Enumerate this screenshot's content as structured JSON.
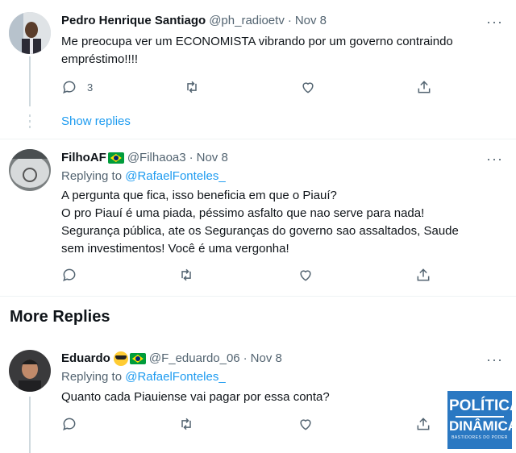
{
  "tweets": [
    {
      "name": "Pedro Henrique Santiago",
      "handle": "@ph_radioetv",
      "time": "Nov 8",
      "text_lines": [
        "Me preocupa ver um ECONOMISTA vibrando por um governo contraindo",
        "empréstimo!!!!"
      ],
      "reply_count": "3",
      "show_replies": "Show replies"
    },
    {
      "name": "FilhoAF",
      "handle": "@Filhaoa3",
      "time": "Nov 8",
      "replying_to": "Replying to",
      "mention": "@RafaelFonteles_",
      "text_lines": [
        "A pergunta que fica, isso beneficia em que o  Piauí?",
        "O pro Piauí é uma piada, péssimo asfalto que nao serve para nada!",
        "Segurança pública, ate os Seguranças do governo sao assaltados, Saude",
        "sem investimentos! Você é uma vergonha!"
      ]
    },
    {
      "name": "Eduardo",
      "handle": "@F_eduardo_06",
      "time": "Nov 8",
      "replying_to": "Replying to",
      "mention": "@RafaelFonteles_",
      "text_lines": [
        "Quanto cada Piauiense vai pagar por essa conta?"
      ]
    }
  ],
  "section_title": "More Replies",
  "more_icon_text": "···",
  "logo": {
    "line1": "POLÍTICA",
    "line2": "DINÂMICA",
    "line3": "BASTIDORES DO PODER"
  },
  "colors": {
    "accent": "#1d9bf0",
    "muted": "#536471",
    "logo_blue": "#2a78c2"
  },
  "icons": [
    "reply-icon",
    "retweet-icon",
    "like-icon",
    "share-icon",
    "more-icon"
  ]
}
